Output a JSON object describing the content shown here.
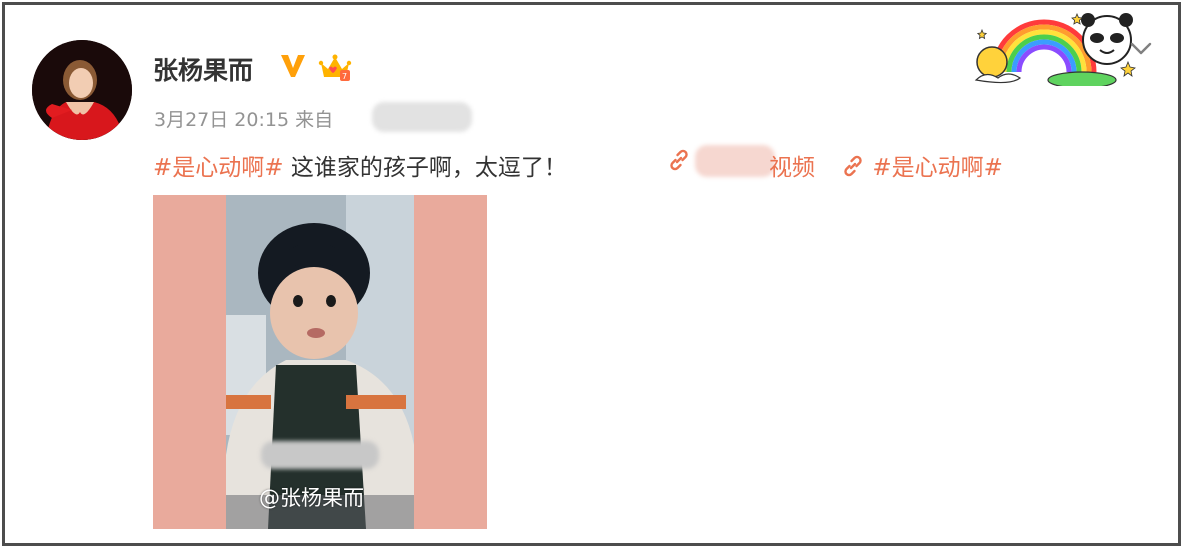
{
  "post": {
    "username": "张杨果而",
    "date": "3月27日 20:15",
    "source_prefix": "来自",
    "topic_tag": "#是心动啊#",
    "body_text": " 这谁家的孩子啊，太逗了！",
    "link1_label": "视频",
    "link2_label": "#是心动啊#",
    "video_watermark": "@张杨果而"
  },
  "icons": {
    "verified": "verified-v-icon",
    "member": "crown-member-icon",
    "link": "link-chain-icon",
    "expand": "chevron-down-icon"
  },
  "colors": {
    "accent": "#eb7350",
    "verified": "#ffa00a",
    "meta": "#939393",
    "media_bg": "#e9aa9c"
  }
}
